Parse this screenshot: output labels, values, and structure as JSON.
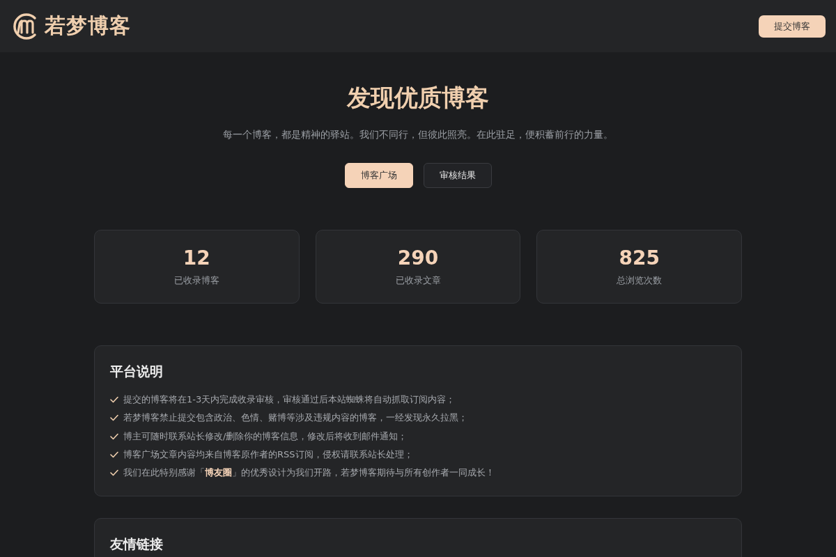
{
  "header": {
    "logo_text": "若梦博客",
    "submit_button": "提交博客"
  },
  "hero": {
    "title": "发现优质博客",
    "subtitle": "每一个博客，都是精神的驿站。我们不同行，但彼此照亮。在此驻足，便积蓄前行的力量。"
  },
  "tabs": [
    {
      "label": "博客广场",
      "selected": true
    },
    {
      "label": "审核结果",
      "selected": false
    }
  ],
  "stats": [
    {
      "value": "12",
      "label": "已收录博客"
    },
    {
      "value": "290",
      "label": "已收录文章"
    },
    {
      "value": "825",
      "label": "总浏览次数"
    }
  ],
  "notice": {
    "title": "平台说明",
    "items": [
      "提交的博客将在1-3天内完成收录审核，审核通过后本站蜘蛛将自动抓取订阅内容；",
      "若梦博客禁止提交包含政治、色情、赌博等涉及违规内容的博客，一经发现永久拉黑；",
      "博主可随时联系站长修改/删除你的博客信息，修改后将收到邮件通知；",
      "博客广场文章内容均来自博客原作者的RSS订阅，侵权请联系站长处理；",
      "我们在此特别感谢「**博友圈**」的优秀设计为我们开路，若梦博客期待与所有创作者一同成长！"
    ]
  },
  "links": {
    "title": "友情链接"
  }
}
